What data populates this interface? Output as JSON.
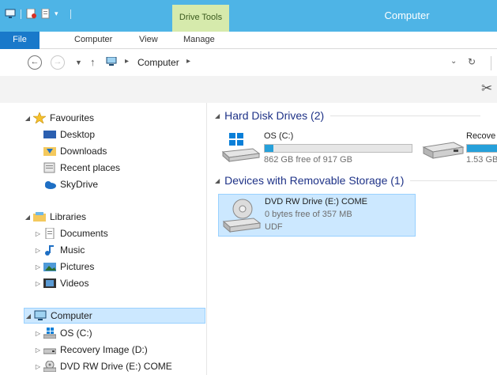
{
  "titlebar": {
    "title": "Computer",
    "contextual_tab": "Drive Tools"
  },
  "ribbon": {
    "tabs": [
      "File",
      "Computer",
      "View",
      "Manage"
    ]
  },
  "address": {
    "location": "Computer"
  },
  "nav": {
    "favourites": {
      "label": "Favourites",
      "items": [
        "Desktop",
        "Downloads",
        "Recent places",
        "SkyDrive"
      ]
    },
    "libraries": {
      "label": "Libraries",
      "items": [
        "Documents",
        "Music",
        "Pictures",
        "Videos"
      ]
    },
    "computer": {
      "label": "Computer",
      "items": [
        "OS (C:)",
        "Recovery Image (D:)",
        "DVD RW Drive (E:) COME"
      ]
    }
  },
  "content": {
    "hard_disk_group": "Hard Disk Drives (2)",
    "removable_group": "Devices with Removable Storage (1)",
    "drives": [
      {
        "name": "OS (C:)",
        "free_text": "862 GB free of 917 GB",
        "used_fraction": 0.06
      },
      {
        "name": "Recove",
        "free_text": "1.53 GB",
        "used_fraction": 0.9
      }
    ],
    "removable": {
      "name": "DVD RW Drive (E:) COME",
      "free_text": "0 bytes free of 357 MB",
      "fs": "UDF"
    }
  },
  "colors": {
    "titlebar": "#4eb4e6",
    "file_tab": "#1979ca",
    "drive_tools": "#d6eaac",
    "selection": "#cce8ff",
    "usage_bar": "#26a0da",
    "group_header": "#1e3287"
  }
}
